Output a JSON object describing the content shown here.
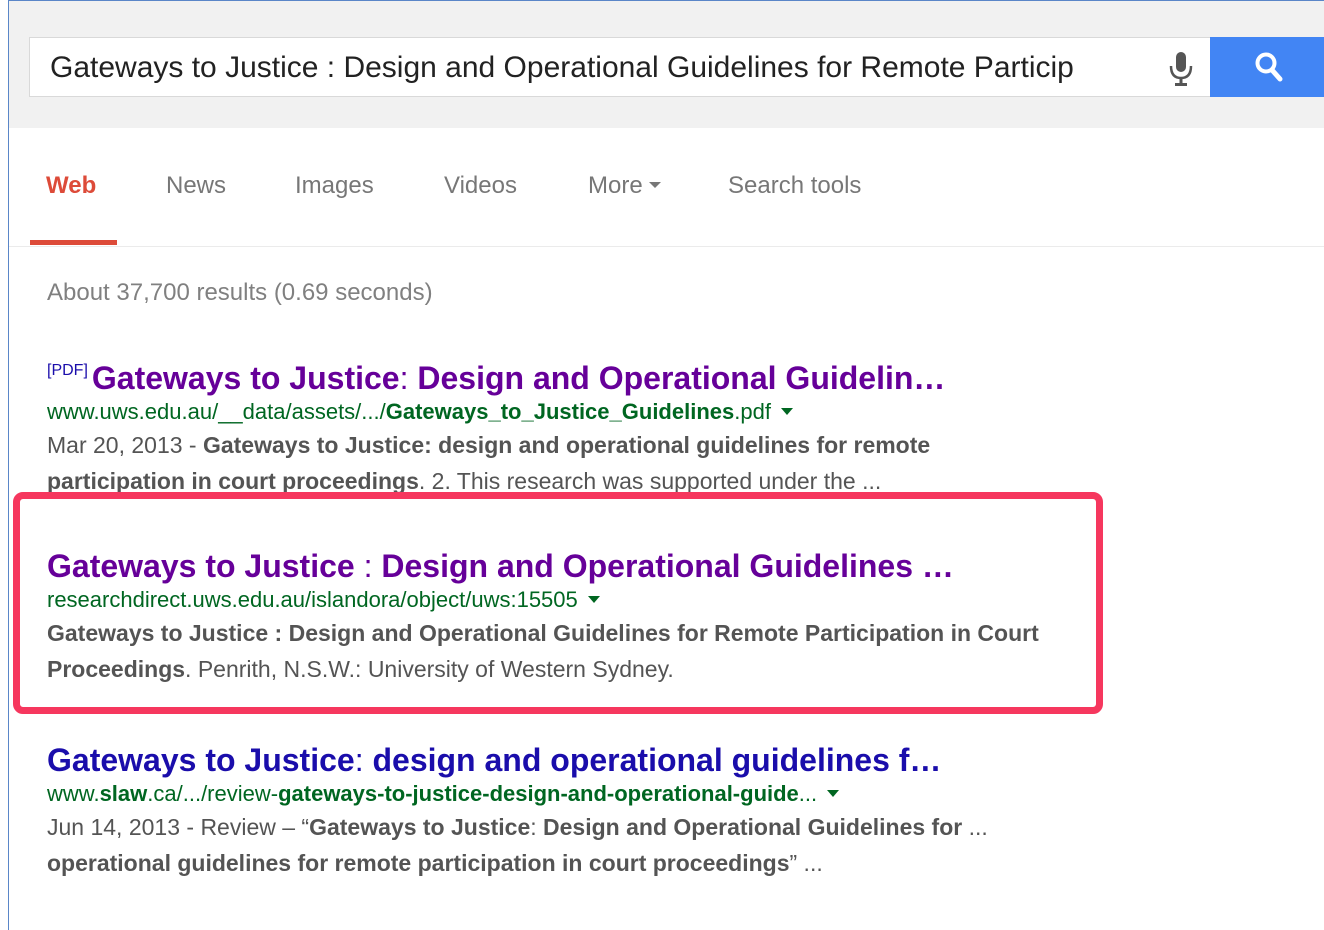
{
  "search": {
    "query": "Gateways to Justice : Design and Operational Guidelines for Remote Particip"
  },
  "tabs": [
    {
      "label": "Web",
      "active": true
    },
    {
      "label": "News"
    },
    {
      "label": "Images"
    },
    {
      "label": "Videos"
    },
    {
      "label": "More"
    },
    {
      "label": "Search tools"
    }
  ],
  "stats": "About 37,700 results (0.69 seconds)",
  "results": [
    {
      "badge": "[PDF]",
      "title_a": "Gateways to Justice",
      "title_sep": ": ",
      "title_b": "Design and Operational Guidelin…",
      "url_a": "www.uws.edu.au/__data/assets/.../",
      "url_b": "Gateways_to_Justice_Guidelines",
      "url_c": ".pdf",
      "date": "Mar 20, 2013 - ",
      "snip_b1": "Gateways to Justice: design and operational guidelines for remote participation in court proceedings",
      "snip_rest": ". 2. This research was supported under the ..."
    },
    {
      "title_a": "Gateways to Justice",
      "title_sep": " : ",
      "title_b": "Design and Operational Guidelines …",
      "url": "researchdirect.uws.edu.au/islandora/object/uws:15505",
      "snip_b1": "Gateways to Justice : Design and Operational Guidelines for Remote Participation in Court Proceedings",
      "snip_rest": ". Penrith, N.S.W.: University of Western Sydney."
    },
    {
      "title_a": "Gateways to Justice",
      "title_sep": ": ",
      "title_b": "design and operational guidelines f…",
      "url_a": "www.",
      "url_b": "slaw",
      "url_c": ".ca/.../review-",
      "url_d": "gateways-to-justice-design-and-operational-guide",
      "url_e": "...",
      "date": "Jun 14, 2013 - Review – “",
      "snip_b1": "Gateways to Justice",
      "snip_m1": ": ",
      "snip_b2": "Design and Operational Guidelines for",
      "snip_m2": " ... ",
      "snip_b3": "operational guidelines for remote participation in court proceedings",
      "snip_m3": "” ..."
    }
  ]
}
